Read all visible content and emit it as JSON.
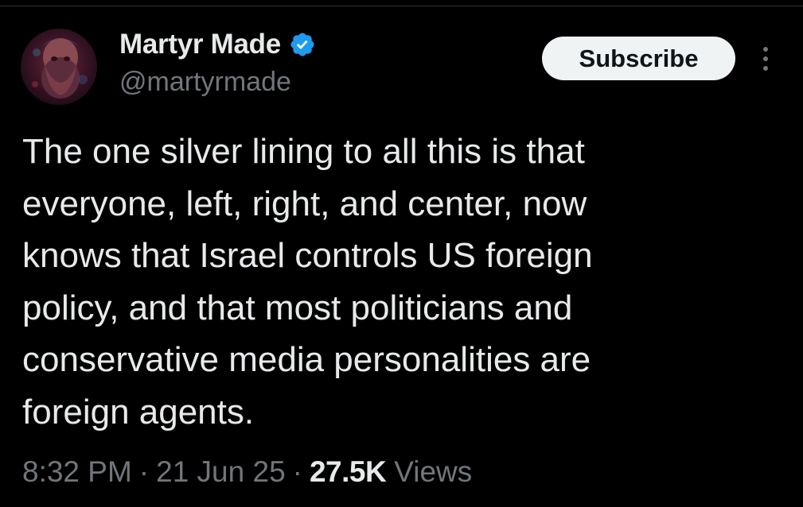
{
  "author": {
    "display_name": "Martyr Made",
    "handle": "@martyrmade",
    "verified": true,
    "verified_badge_color": "#1d9bf0"
  },
  "actions": {
    "subscribe_label": "Subscribe",
    "more_icon": "more-vertical-icon"
  },
  "tweet": {
    "text_lines": [
      "The one silver lining to all this is that",
      "everyone, left, right, and center, now",
      "knows that Israel controls US foreign",
      "policy, and that most politicians and",
      "conservative media personalities are",
      "foreign agents."
    ]
  },
  "meta": {
    "time": "8:32 PM",
    "separator": "·",
    "date": "21 Jun 25",
    "views_count": "27.5K",
    "views_label": "Views"
  },
  "theme": {
    "background": "#000000",
    "text_primary": "#e7e9ea",
    "text_secondary": "#71767b",
    "button_bg": "#eff3f4"
  }
}
